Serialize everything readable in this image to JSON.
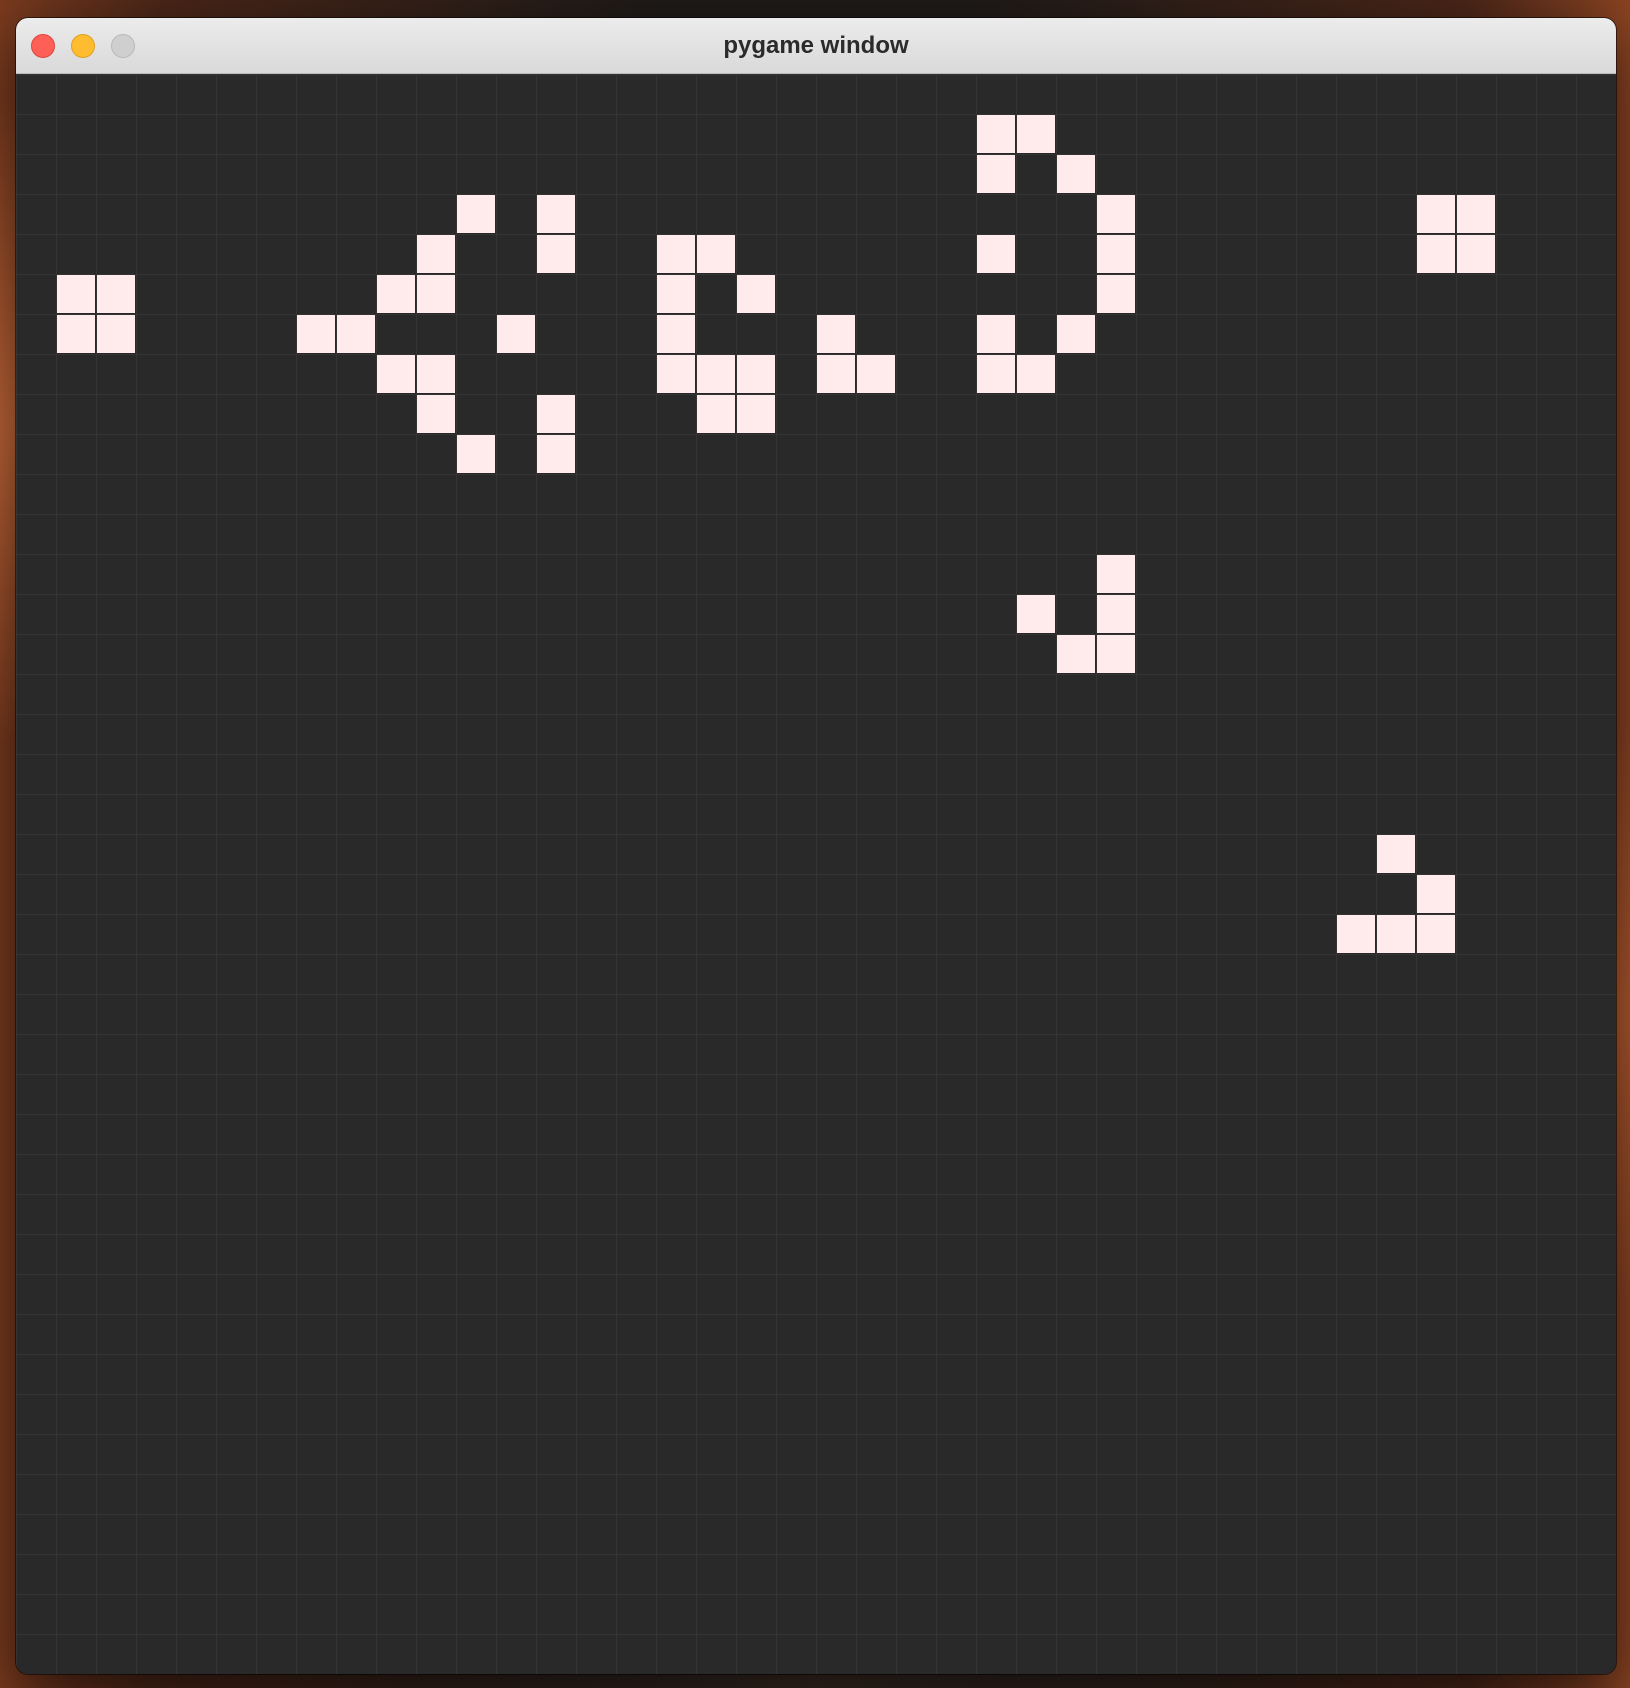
{
  "window": {
    "title": "pygame window"
  },
  "colors": {
    "background": "#292929",
    "grid_line": "#343434",
    "live_cell": "#ffeaec",
    "close_button": "#fe5f57",
    "minimize_button": "#febc2e",
    "zoom_button_disabled": "#cfcfcf"
  },
  "grid": {
    "columns": 40,
    "rows": 40,
    "live_cells": [
      [
        1,
        5
      ],
      [
        2,
        5
      ],
      [
        1,
        6
      ],
      [
        2,
        6
      ],
      [
        7,
        6
      ],
      [
        8,
        6
      ],
      [
        9,
        5
      ],
      [
        10,
        5
      ],
      [
        10,
        4
      ],
      [
        11,
        3
      ],
      [
        9,
        7
      ],
      [
        10,
        7
      ],
      [
        10,
        8
      ],
      [
        11,
        9
      ],
      [
        12,
        6
      ],
      [
        13,
        3
      ],
      [
        13,
        4
      ],
      [
        13,
        8
      ],
      [
        13,
        9
      ],
      [
        16,
        4
      ],
      [
        17,
        4
      ],
      [
        16,
        5
      ],
      [
        18,
        5
      ],
      [
        16,
        6
      ],
      [
        16,
        7
      ],
      [
        17,
        7
      ],
      [
        18,
        7
      ],
      [
        17,
        8
      ],
      [
        18,
        8
      ],
      [
        20,
        6
      ],
      [
        20,
        7
      ],
      [
        21,
        7
      ],
      [
        24,
        1
      ],
      [
        25,
        1
      ],
      [
        24,
        2
      ],
      [
        26,
        2
      ],
      [
        27,
        3
      ],
      [
        24,
        4
      ],
      [
        27,
        4
      ],
      [
        27,
        5
      ],
      [
        24,
        6
      ],
      [
        26,
        6
      ],
      [
        24,
        7
      ],
      [
        25,
        7
      ],
      [
        35,
        3
      ],
      [
        36,
        3
      ],
      [
        35,
        4
      ],
      [
        36,
        4
      ],
      [
        27,
        12
      ],
      [
        25,
        13
      ],
      [
        27,
        13
      ],
      [
        26,
        14
      ],
      [
        27,
        14
      ],
      [
        34,
        19
      ],
      [
        35,
        20
      ],
      [
        33,
        21
      ],
      [
        34,
        21
      ],
      [
        35,
        21
      ]
    ]
  }
}
